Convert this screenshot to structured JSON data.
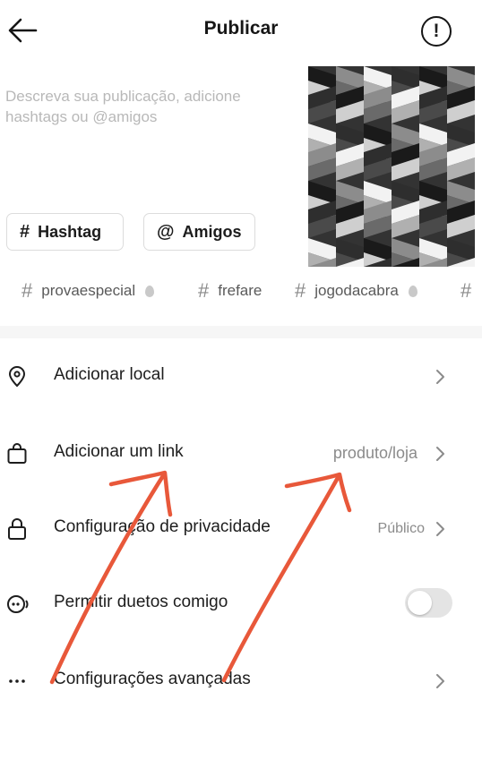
{
  "header": {
    "title": "Publicar",
    "info_symbol": "!"
  },
  "caption": {
    "placeholder": "Descreva sua publicação, adicione hashtags ou @amigos"
  },
  "chips": {
    "hashtag": {
      "symbol": "#",
      "label": "Hashtag"
    },
    "amigos": {
      "symbol": "@",
      "label": "Amigos"
    }
  },
  "suggestions": [
    {
      "label": "provaespecial",
      "hot": true
    },
    {
      "label": "frefare",
      "hot": false
    },
    {
      "label": "jogodacabra",
      "hot": true
    },
    {
      "label": "",
      "hot": false
    }
  ],
  "settings": {
    "local": {
      "label": "Adicionar local"
    },
    "link": {
      "label": "Adicionar um link",
      "value": "produto/loja"
    },
    "privacy": {
      "label": "Configuração de privacidade",
      "value": "Público"
    },
    "duet": {
      "label": "Permitir duetos comigo",
      "enabled": false
    },
    "advanced": {
      "label": "Configurações avançadas"
    }
  },
  "colors": {
    "annotation_arrow": "#e8583a",
    "toggle_off": "#e4e4e4"
  },
  "icons": [
    "back-arrow-icon",
    "info-icon",
    "location-pin-icon",
    "shopping-bag-icon",
    "lock-icon",
    "duet-icon",
    "more-icon",
    "chevron-right-icon",
    "flame-icon"
  ]
}
